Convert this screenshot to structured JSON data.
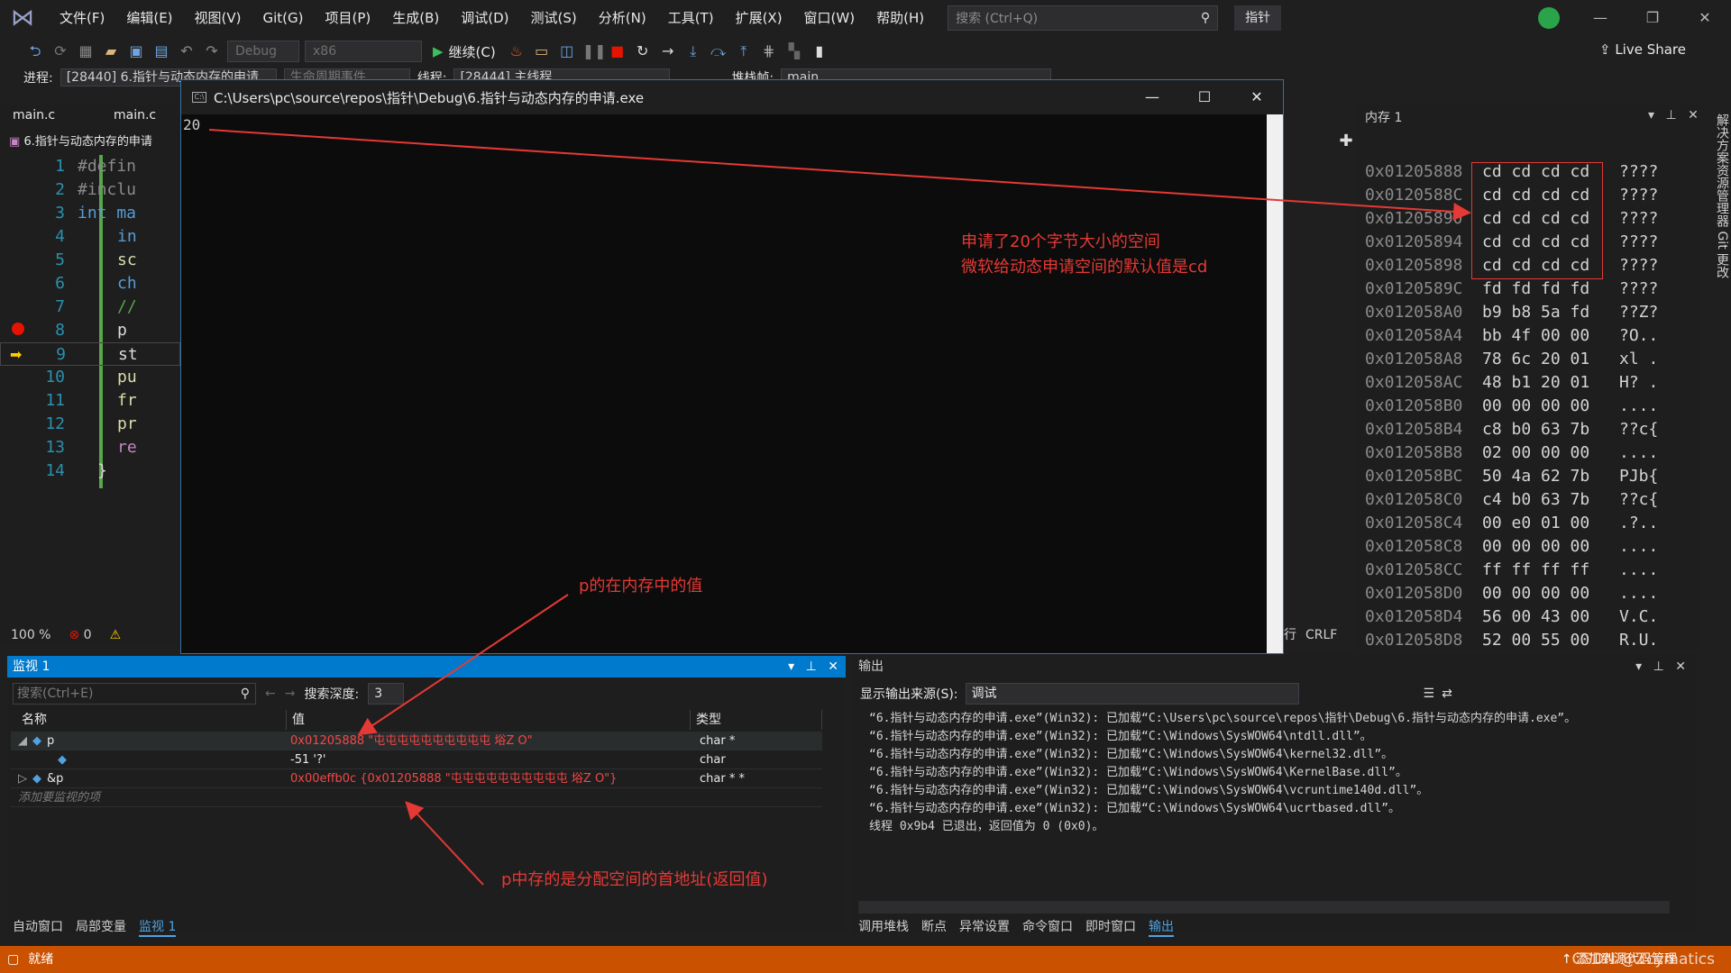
{
  "menu": {
    "items": [
      "文件(F)",
      "编辑(E)",
      "视图(V)",
      "Git(G)",
      "项目(P)",
      "生成(B)",
      "调试(D)",
      "测试(S)",
      "分析(N)",
      "工具(T)",
      "扩展(X)",
      "窗口(W)",
      "帮助(H)"
    ],
    "search_placeholder": "搜索 (Ctrl+Q)",
    "solution_name": "指针"
  },
  "toolbar": {
    "config": "Debug",
    "platform": "x86",
    "continue_label": "继续(C)",
    "live_share": "Live Share"
  },
  "processbar": {
    "process_label": "进程:",
    "process_value": "[28440] 6.指针与动态内存的申请",
    "lifecycle_label": "生命周期事件",
    "thread_label": "线程:",
    "thread_value": "[28444] 主线程",
    "stack_label": "堆栈帧:",
    "stack_value": "main"
  },
  "editor": {
    "tabs": [
      "main.c",
      "main.c"
    ],
    "nav_label": "6.指针与动态内存的申请",
    "lines": [
      {
        "n": "1",
        "text": "#defin"
      },
      {
        "n": "2",
        "text": "#inclu"
      },
      {
        "n": "3",
        "text": "int ma"
      },
      {
        "n": "4",
        "text": "in"
      },
      {
        "n": "5",
        "text": "sc"
      },
      {
        "n": "6",
        "text": "ch"
      },
      {
        "n": "7",
        "text": "//"
      },
      {
        "n": "8",
        "text": "p"
      },
      {
        "n": "9",
        "text": "st"
      },
      {
        "n": "10",
        "text": "pu"
      },
      {
        "n": "11",
        "text": "fr"
      },
      {
        "n": "12",
        "text": "pr"
      },
      {
        "n": "13",
        "text": "re"
      },
      {
        "n": "14",
        "text": "}"
      }
    ],
    "zoom": "100 %",
    "errors": "0",
    "line_ending": "CRLF",
    "line_ending_prefix": "行"
  },
  "console": {
    "title": "C:\\Users\\pc\\source\\repos\\指针\\Debug\\6.指针与动态内存的申请.exe",
    "output": "20"
  },
  "memory": {
    "title": "内存 1",
    "rows": [
      {
        "addr": "0x01205888",
        "bytes": "cd cd cd cd",
        "chars": "????"
      },
      {
        "addr": "0x0120588C",
        "bytes": "cd cd cd cd",
        "chars": "????"
      },
      {
        "addr": "0x01205890",
        "bytes": "cd cd cd cd",
        "chars": "????"
      },
      {
        "addr": "0x01205894",
        "bytes": "cd cd cd cd",
        "chars": "????"
      },
      {
        "addr": "0x01205898",
        "bytes": "cd cd cd cd",
        "chars": "????"
      },
      {
        "addr": "0x0120589C",
        "bytes": "fd fd fd fd",
        "chars": "????"
      },
      {
        "addr": "0x012058A0",
        "bytes": "b9 b8 5a fd",
        "chars": "??Z?"
      },
      {
        "addr": "0x012058A4",
        "bytes": "bb 4f 00 00",
        "chars": "?O.."
      },
      {
        "addr": "0x012058A8",
        "bytes": "78 6c 20 01",
        "chars": "xl ."
      },
      {
        "addr": "0x012058AC",
        "bytes": "48 b1 20 01",
        "chars": "H? ."
      },
      {
        "addr": "0x012058B0",
        "bytes": "00 00 00 00",
        "chars": "...."
      },
      {
        "addr": "0x012058B4",
        "bytes": "c8 b0 63 7b",
        "chars": "??c{"
      },
      {
        "addr": "0x012058B8",
        "bytes": "02 00 00 00",
        "chars": "...."
      },
      {
        "addr": "0x012058BC",
        "bytes": "50 4a 62 7b",
        "chars": "PJb{"
      },
      {
        "addr": "0x012058C0",
        "bytes": "c4 b0 63 7b",
        "chars": "??c{"
      },
      {
        "addr": "0x012058C4",
        "bytes": "00 e0 01 00",
        "chars": ".?.."
      },
      {
        "addr": "0x012058C8",
        "bytes": "00 00 00 00",
        "chars": "...."
      },
      {
        "addr": "0x012058CC",
        "bytes": "ff ff ff ff",
        "chars": "...."
      },
      {
        "addr": "0x012058D0",
        "bytes": "00 00 00 00",
        "chars": "...."
      },
      {
        "addr": "0x012058D4",
        "bytes": "56 00 43 00",
        "chars": "V.C."
      },
      {
        "addr": "0x012058D8",
        "bytes": "52 00 55 00",
        "chars": "R.U."
      }
    ],
    "right_tabs": "解决方案资源管理器  Git 更改"
  },
  "watch": {
    "title": "监视 1",
    "search_placeholder": "搜索(Ctrl+E)",
    "depth_label": "搜索深度:",
    "depth_value": "3",
    "columns": [
      "名称",
      "值",
      "类型"
    ],
    "rows": [
      {
        "name": "p",
        "value": "0x01205888 \"屯屯屯屯屯屯屯屯屯屯        﨏Z   O\"",
        "type": "char *"
      },
      {
        "name": "",
        "value": "-51 '?'",
        "type": "char"
      },
      {
        "name": "&p",
        "value": "0x00effb0c {0x01205888 \"屯屯屯屯屯屯屯屯屯屯        﨏Z   O\"}",
        "type": "char * *"
      }
    ],
    "add_item": "添加要监视的项",
    "bottom_tabs": [
      "自动窗口",
      "局部变量",
      "监视 1"
    ]
  },
  "output": {
    "title": "输出",
    "source_label": "显示输出来源(S):",
    "source_value": "调试",
    "lines": [
      "“6.指针与动态内存的申请.exe”(Win32): 已加载“C:\\Users\\pc\\source\\repos\\指针\\Debug\\6.指针与动态内存的申请.exe”。",
      "“6.指针与动态内存的申请.exe”(Win32): 已加载“C:\\Windows\\SysWOW64\\ntdll.dll”。",
      "“6.指针与动态内存的申请.exe”(Win32): 已加载“C:\\Windows\\SysWOW64\\kernel32.dll”。",
      "“6.指针与动态内存的申请.exe”(Win32): 已加载“C:\\Windows\\SysWOW64\\KernelBase.dll”。",
      "“6.指针与动态内存的申请.exe”(Win32): 已加载“C:\\Windows\\SysWOW64\\vcruntime140d.dll”。",
      "“6.指针与动态内存的申请.exe”(Win32): 已加载“C:\\Windows\\SysWOW64\\ucrtbased.dll”。",
      "线程 0x9b4 已退出，返回值为 0 (0x0)。"
    ],
    "bottom_tabs": [
      "调用堆栈",
      "断点",
      "异常设置",
      "命令窗口",
      "即时窗口",
      "输出"
    ]
  },
  "status": {
    "ready": "就绪",
    "add_source": "添加到源代码管理",
    "watermark": "CSDN @Zcymatics"
  },
  "annotations": {
    "mem_note_1": "申请了20个字节大小的空间",
    "mem_note_2": "微软给动态申请空间的默认值是cd",
    "p_value_note": "p的在内存中的值",
    "p_addr_note": "p中存的是分配空间的首地址(返回值)"
  },
  "colors": {
    "accent": "#007acc",
    "status_bar": "#ca5100",
    "annotation": "#e53935"
  }
}
